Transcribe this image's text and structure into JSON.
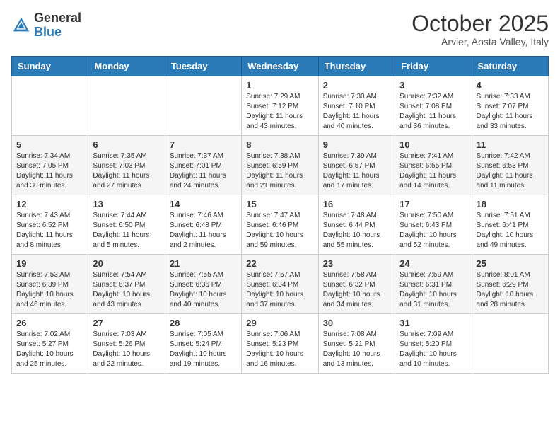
{
  "header": {
    "logo_general": "General",
    "logo_blue": "Blue",
    "month": "October 2025",
    "location": "Arvier, Aosta Valley, Italy"
  },
  "days_of_week": [
    "Sunday",
    "Monday",
    "Tuesday",
    "Wednesday",
    "Thursday",
    "Friday",
    "Saturday"
  ],
  "weeks": [
    [
      {
        "day": "",
        "sunrise": "",
        "sunset": "",
        "daylight": ""
      },
      {
        "day": "",
        "sunrise": "",
        "sunset": "",
        "daylight": ""
      },
      {
        "day": "",
        "sunrise": "",
        "sunset": "",
        "daylight": ""
      },
      {
        "day": "1",
        "sunrise": "Sunrise: 7:29 AM",
        "sunset": "Sunset: 7:12 PM",
        "daylight": "Daylight: 11 hours and 43 minutes."
      },
      {
        "day": "2",
        "sunrise": "Sunrise: 7:30 AM",
        "sunset": "Sunset: 7:10 PM",
        "daylight": "Daylight: 11 hours and 40 minutes."
      },
      {
        "day": "3",
        "sunrise": "Sunrise: 7:32 AM",
        "sunset": "Sunset: 7:08 PM",
        "daylight": "Daylight: 11 hours and 36 minutes."
      },
      {
        "day": "4",
        "sunrise": "Sunrise: 7:33 AM",
        "sunset": "Sunset: 7:07 PM",
        "daylight": "Daylight: 11 hours and 33 minutes."
      }
    ],
    [
      {
        "day": "5",
        "sunrise": "Sunrise: 7:34 AM",
        "sunset": "Sunset: 7:05 PM",
        "daylight": "Daylight: 11 hours and 30 minutes."
      },
      {
        "day": "6",
        "sunrise": "Sunrise: 7:35 AM",
        "sunset": "Sunset: 7:03 PM",
        "daylight": "Daylight: 11 hours and 27 minutes."
      },
      {
        "day": "7",
        "sunrise": "Sunrise: 7:37 AM",
        "sunset": "Sunset: 7:01 PM",
        "daylight": "Daylight: 11 hours and 24 minutes."
      },
      {
        "day": "8",
        "sunrise": "Sunrise: 7:38 AM",
        "sunset": "Sunset: 6:59 PM",
        "daylight": "Daylight: 11 hours and 21 minutes."
      },
      {
        "day": "9",
        "sunrise": "Sunrise: 7:39 AM",
        "sunset": "Sunset: 6:57 PM",
        "daylight": "Daylight: 11 hours and 17 minutes."
      },
      {
        "day": "10",
        "sunrise": "Sunrise: 7:41 AM",
        "sunset": "Sunset: 6:55 PM",
        "daylight": "Daylight: 11 hours and 14 minutes."
      },
      {
        "day": "11",
        "sunrise": "Sunrise: 7:42 AM",
        "sunset": "Sunset: 6:53 PM",
        "daylight": "Daylight: 11 hours and 11 minutes."
      }
    ],
    [
      {
        "day": "12",
        "sunrise": "Sunrise: 7:43 AM",
        "sunset": "Sunset: 6:52 PM",
        "daylight": "Daylight: 11 hours and 8 minutes."
      },
      {
        "day": "13",
        "sunrise": "Sunrise: 7:44 AM",
        "sunset": "Sunset: 6:50 PM",
        "daylight": "Daylight: 11 hours and 5 minutes."
      },
      {
        "day": "14",
        "sunrise": "Sunrise: 7:46 AM",
        "sunset": "Sunset: 6:48 PM",
        "daylight": "Daylight: 11 hours and 2 minutes."
      },
      {
        "day": "15",
        "sunrise": "Sunrise: 7:47 AM",
        "sunset": "Sunset: 6:46 PM",
        "daylight": "Daylight: 10 hours and 59 minutes."
      },
      {
        "day": "16",
        "sunrise": "Sunrise: 7:48 AM",
        "sunset": "Sunset: 6:44 PM",
        "daylight": "Daylight: 10 hours and 55 minutes."
      },
      {
        "day": "17",
        "sunrise": "Sunrise: 7:50 AM",
        "sunset": "Sunset: 6:43 PM",
        "daylight": "Daylight: 10 hours and 52 minutes."
      },
      {
        "day": "18",
        "sunrise": "Sunrise: 7:51 AM",
        "sunset": "Sunset: 6:41 PM",
        "daylight": "Daylight: 10 hours and 49 minutes."
      }
    ],
    [
      {
        "day": "19",
        "sunrise": "Sunrise: 7:53 AM",
        "sunset": "Sunset: 6:39 PM",
        "daylight": "Daylight: 10 hours and 46 minutes."
      },
      {
        "day": "20",
        "sunrise": "Sunrise: 7:54 AM",
        "sunset": "Sunset: 6:37 PM",
        "daylight": "Daylight: 10 hours and 43 minutes."
      },
      {
        "day": "21",
        "sunrise": "Sunrise: 7:55 AM",
        "sunset": "Sunset: 6:36 PM",
        "daylight": "Daylight: 10 hours and 40 minutes."
      },
      {
        "day": "22",
        "sunrise": "Sunrise: 7:57 AM",
        "sunset": "Sunset: 6:34 PM",
        "daylight": "Daylight: 10 hours and 37 minutes."
      },
      {
        "day": "23",
        "sunrise": "Sunrise: 7:58 AM",
        "sunset": "Sunset: 6:32 PM",
        "daylight": "Daylight: 10 hours and 34 minutes."
      },
      {
        "day": "24",
        "sunrise": "Sunrise: 7:59 AM",
        "sunset": "Sunset: 6:31 PM",
        "daylight": "Daylight: 10 hours and 31 minutes."
      },
      {
        "day": "25",
        "sunrise": "Sunrise: 8:01 AM",
        "sunset": "Sunset: 6:29 PM",
        "daylight": "Daylight: 10 hours and 28 minutes."
      }
    ],
    [
      {
        "day": "26",
        "sunrise": "Sunrise: 7:02 AM",
        "sunset": "Sunset: 5:27 PM",
        "daylight": "Daylight: 10 hours and 25 minutes."
      },
      {
        "day": "27",
        "sunrise": "Sunrise: 7:03 AM",
        "sunset": "Sunset: 5:26 PM",
        "daylight": "Daylight: 10 hours and 22 minutes."
      },
      {
        "day": "28",
        "sunrise": "Sunrise: 7:05 AM",
        "sunset": "Sunset: 5:24 PM",
        "daylight": "Daylight: 10 hours and 19 minutes."
      },
      {
        "day": "29",
        "sunrise": "Sunrise: 7:06 AM",
        "sunset": "Sunset: 5:23 PM",
        "daylight": "Daylight: 10 hours and 16 minutes."
      },
      {
        "day": "30",
        "sunrise": "Sunrise: 7:08 AM",
        "sunset": "Sunset: 5:21 PM",
        "daylight": "Daylight: 10 hours and 13 minutes."
      },
      {
        "day": "31",
        "sunrise": "Sunrise: 7:09 AM",
        "sunset": "Sunset: 5:20 PM",
        "daylight": "Daylight: 10 hours and 10 minutes."
      },
      {
        "day": "",
        "sunrise": "",
        "sunset": "",
        "daylight": ""
      }
    ]
  ]
}
